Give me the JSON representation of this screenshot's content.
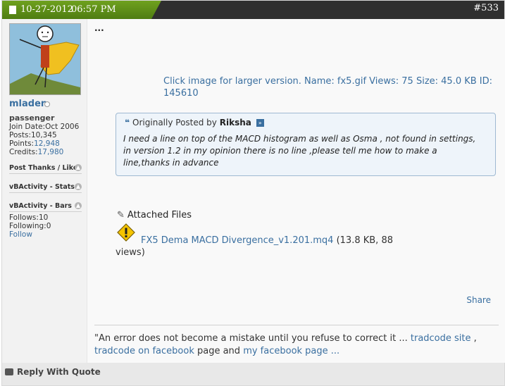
{
  "header": {
    "date": "10-27-2012",
    "time": "06:57 PM",
    "post_number": "#533"
  },
  "user": {
    "name": "mladen",
    "title": "passenger",
    "join_date_label": "Join Date:",
    "join_date": "Oct 2006",
    "posts_label": "Posts:",
    "posts": "10,345",
    "points_label": "Points:",
    "points": "12,948",
    "credits_label": "Credits:",
    "credits": "17,980",
    "sections": [
      "Post Thanks / Like",
      "vBActivity - Stats",
      "vBActivity - Bars"
    ],
    "follows_label": "Follows:",
    "follows": "10",
    "following_label": "Following:",
    "following": "0",
    "follow_link": "Follow"
  },
  "content": {
    "dots": "...",
    "image_caption": "Click image for larger version.  Name: fx5.gif  Views: 75  Size: 45.0 KB  ID: 145610",
    "quote": {
      "prefix": "Originally Posted by",
      "author": "Riksha",
      "text": "I need a line on top of the MACD histogram as well as Osma , not found in settings, in version 1.2 in my opinion there is no line ,please tell me how to make a line,thanks in advance"
    },
    "attached_label": "Attached Files",
    "file": {
      "name": "FX5 Dema MACD Divergence_v1.201.mq4",
      "meta": " (13.8 KB, 88 views)"
    },
    "share": "Share",
    "signature": {
      "text1": "\"An error does not become a mistake until you refuse to correct it ... ",
      "link1": "tradcode site",
      "text2": " ,",
      "link2": "tradcode on facebook",
      "text3": " page and ",
      "link3": "my facebook page ..."
    }
  },
  "footer": {
    "reply_with_quote": "Reply With Quote"
  }
}
